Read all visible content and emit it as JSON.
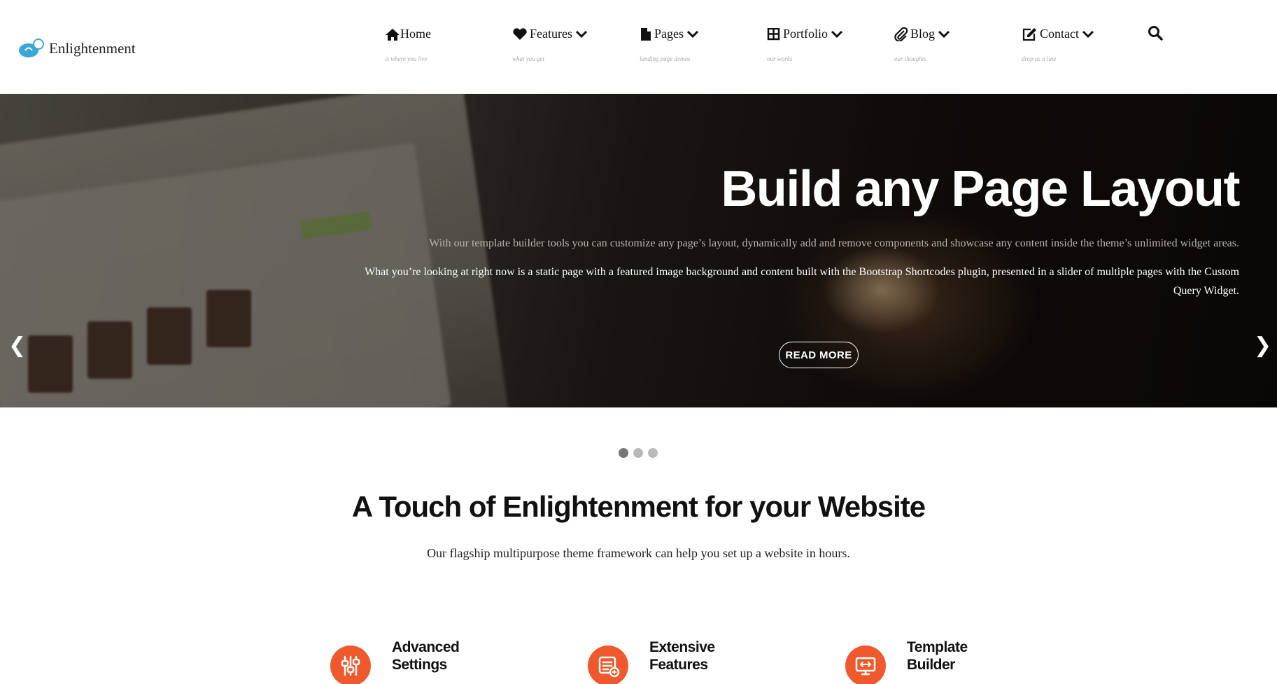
{
  "brand": {
    "name": "Enlightenment"
  },
  "nav": {
    "items": [
      {
        "label": "Home",
        "sub": "is where you live",
        "icon": "home-icon",
        "dropdown": false
      },
      {
        "label": "Features",
        "sub": "what you get",
        "icon": "heart-icon",
        "dropdown": true
      },
      {
        "label": "Pages",
        "sub": "landing page demos",
        "icon": "file-icon",
        "dropdown": true
      },
      {
        "label": "Portfolio",
        "sub": "our works",
        "icon": "grid-icon",
        "dropdown": true
      },
      {
        "label": "Blog",
        "sub": "our thoughts",
        "icon": "paperclip-icon",
        "dropdown": true
      },
      {
        "label": "Contact",
        "sub": "drop us a line",
        "icon": "edit-icon",
        "dropdown": true
      }
    ],
    "search_icon": "search-icon"
  },
  "hero": {
    "title": "Build any Page Layout",
    "paragraph1": "With our template builder tools you can customize any page’s layout, dynamically add and remove components and showcase any content inside the theme’s unlimited widget areas.",
    "paragraph2": "What you’re looking at right now is a static page with a featured image background and content built with the Bootstrap Shortcodes plugin, presented in a slider of multiple pages with the Custom Query Widget.",
    "button": "READ MORE",
    "prev_arrow": "❮",
    "next_arrow": "❯"
  },
  "slider": {
    "slides": 3,
    "active": 0
  },
  "intro": {
    "title": "A Touch of Enlightenment for your Website",
    "subtitle": "Our flagship multipurpose theme framework can help you set up a website in hours."
  },
  "features": [
    {
      "title": "Advanced Settings",
      "icon": "sliders-icon"
    },
    {
      "title": "Extensive Features",
      "icon": "list-add-icon"
    },
    {
      "title": "Template Builder",
      "icon": "monitor-icon"
    }
  ],
  "colors": {
    "accent": "#f0582e",
    "logo_blue": "#3aa6d8"
  }
}
